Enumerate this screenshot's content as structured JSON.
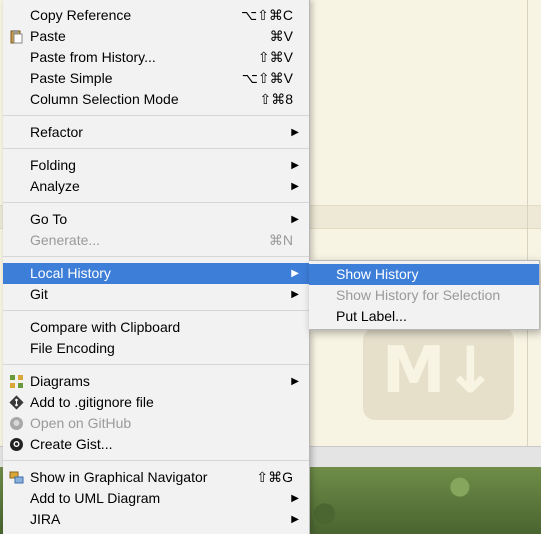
{
  "menu": {
    "items": [
      {
        "label": "Copy Reference",
        "shortcut": "⌥⇧⌘C"
      },
      {
        "label": "Paste",
        "shortcut": "⌘V"
      },
      {
        "label": "Paste from History...",
        "shortcut": "⇧⌘V"
      },
      {
        "label": "Paste Simple",
        "shortcut": "⌥⇧⌘V"
      },
      {
        "label": "Column Selection Mode",
        "shortcut": "⇧⌘8"
      },
      {
        "label": "Refactor"
      },
      {
        "label": "Folding"
      },
      {
        "label": "Analyze"
      },
      {
        "label": "Go To"
      },
      {
        "label": "Generate...",
        "shortcut": "⌘N"
      },
      {
        "label": "Local History"
      },
      {
        "label": "Git"
      },
      {
        "label": "Compare with Clipboard"
      },
      {
        "label": "File Encoding"
      },
      {
        "label": "Diagrams"
      },
      {
        "label": "Add to .gitignore file"
      },
      {
        "label": "Open on GitHub"
      },
      {
        "label": "Create Gist..."
      },
      {
        "label": "Show in Graphical Navigator",
        "shortcut": "⇧⌘G"
      },
      {
        "label": "Add to UML Diagram"
      },
      {
        "label": "JIRA"
      }
    ]
  },
  "submenu": {
    "items": [
      {
        "label": "Show History"
      },
      {
        "label": "Show History for Selection"
      },
      {
        "label": "Put Label..."
      }
    ]
  },
  "arrow": "▶",
  "colors": {
    "selection": "#3d7ed9",
    "disabled_text": "#9a9a9a",
    "menu_bg": "#f2f2f2"
  }
}
